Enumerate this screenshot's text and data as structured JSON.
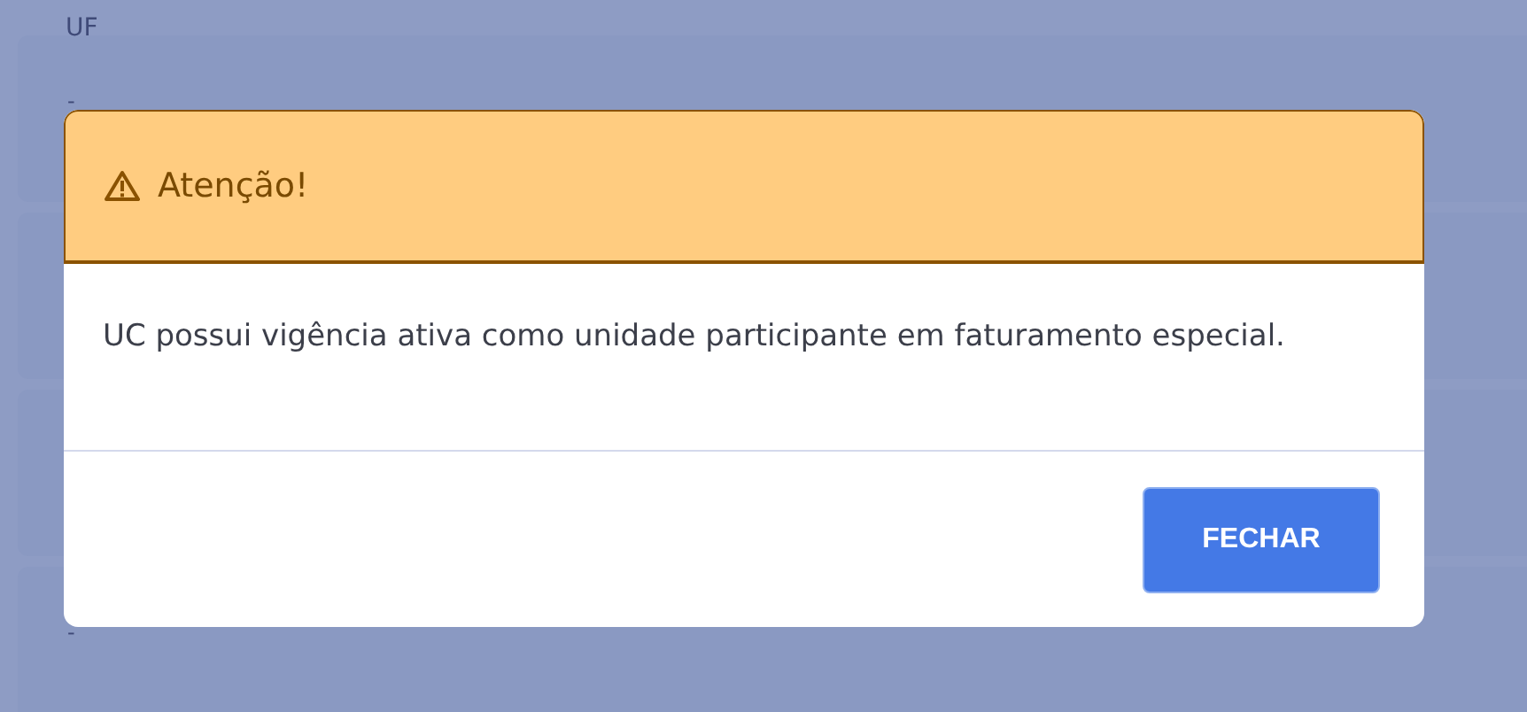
{
  "background": {
    "field_label": "UF",
    "values": [
      "-",
      "-"
    ]
  },
  "dialog": {
    "title": "Atenção!",
    "message": "UC possui vigência ativa como unidade participante em faturamento especial.",
    "buttons": [
      "FECHAR"
    ]
  }
}
